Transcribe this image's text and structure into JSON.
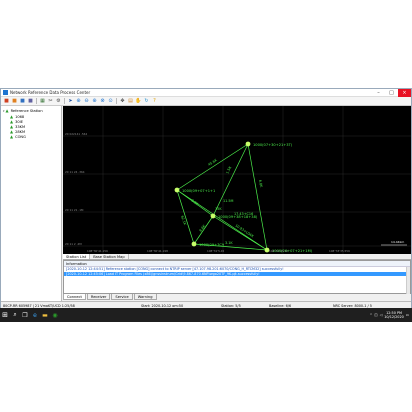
{
  "window": {
    "title": "Network Reference Data Process Center"
  },
  "toolbar": {
    "buttons": [
      {
        "name": "new-icon",
        "glyph": "■",
        "color": "#d04020"
      },
      {
        "name": "open-icon",
        "glyph": "■",
        "color": "#e08020"
      },
      {
        "name": "save-icon",
        "glyph": "■",
        "color": "#3070c0"
      },
      {
        "name": "print-icon",
        "glyph": "■",
        "color": "#6060a0"
      },
      {
        "name": "grid-icon",
        "glyph": "▦",
        "color": "#307030"
      },
      {
        "name": "cut-icon",
        "glyph": "✂",
        "color": "#404040"
      },
      {
        "name": "settings-icon",
        "glyph": "⚙",
        "color": "#505050"
      },
      {
        "name": "arrow-select-icon",
        "glyph": "➤",
        "color": "#2050a0"
      },
      {
        "name": "zoom-in-icon",
        "glyph": "⊕",
        "color": "#1e74d0"
      },
      {
        "name": "zoom-out-icon",
        "glyph": "⊖",
        "color": "#1e74d0"
      },
      {
        "name": "zoom-box-icon",
        "glyph": "⊕",
        "color": "#1e74d0"
      },
      {
        "name": "zoom-fit-icon",
        "glyph": "⊗",
        "color": "#1e74d0"
      },
      {
        "name": "zoom-prev-icon",
        "glyph": "⊙",
        "color": "#1e74d0"
      },
      {
        "name": "pan-icon",
        "glyph": "✥",
        "color": "#3a3a3a"
      },
      {
        "name": "layer-icon",
        "glyph": "▤",
        "color": "#d08020"
      },
      {
        "name": "hand-icon",
        "glyph": "✋",
        "color": "#c08040"
      },
      {
        "name": "refresh-icon",
        "glyph": "↻",
        "color": "#2090d0"
      },
      {
        "name": "help-icon",
        "glyph": "?",
        "color": "#e0a000"
      }
    ]
  },
  "sidebar": {
    "root_label": "Reference Station",
    "stations": [
      "1068",
      "30IE",
      "33KM",
      "28KM",
      "CONG"
    ]
  },
  "map": {
    "y_ticks": [
      "20 022141 .562",
      "20 11 24 .364",
      "20 11 21 .1M",
      "20 11 2 .2M"
    ],
    "x_ticks": [
      "108°30'41.156",
      "108°30'41.198",
      "108°31'5.45",
      "108°31'15.16",
      "108°33'35.556"
    ],
    "scale_label": "14.44km",
    "nodes": [
      {
        "id": "n-top",
        "label": "1000(07+30+21+3T)"
      },
      {
        "id": "n-left",
        "label": "1000(09+07+1+1"
      },
      {
        "id": "n-mid",
        "label": "1000(09+38+18+38)"
      },
      {
        "id": "n-lowleft",
        "label": "1000(09+7C9"
      },
      {
        "id": "n-bottom",
        "label": "1000(26+07+21+1M)"
      }
    ],
    "edge_labels": [
      "45.6K",
      "1.5K",
      "6.8K",
      "0.2K",
      "17.43+C16",
      "62.1K",
      "15K",
      "10.93+L0AK",
      "8.6K",
      "3.1K",
      "11.5M"
    ]
  },
  "tabs_top": [
    "Station List",
    "Base Station Map"
  ],
  "info": {
    "header": "Information",
    "lines": [
      "[2020-10-12 12:44:51] Reference station [CONG] connect to NTRIP server [47.107.98.201:6070/CONG_H_RTCM32] successfully!",
      "[2020-10-12 12:45:06] Load IT Program Files (x86)\\gnssinstrum\\Grid\\9.867-870.6NFtwgo20TF_9K.pjt.successfully!",
      " "
    ]
  },
  "tabs_bottom": [
    "Connect",
    "Receiver",
    "Service",
    "Warning"
  ],
  "status": {
    "left": "80CP-RR 605987 | 21 VmaKT/UCD 1:25/58",
    "start": "Start: 2020-10-12 om:50",
    "station": "Station: 5/5",
    "baseline": "Baseline: 6/6",
    "server": "NRC Server: 8000-1 / 5"
  },
  "taskbar": {
    "apps": [
      {
        "name": "search-icon",
        "glyph": "⌕",
        "color": "#ffffff"
      },
      {
        "name": "task-view-icon",
        "glyph": "❐",
        "color": "#ffffff"
      },
      {
        "name": "edge-icon",
        "glyph": "e",
        "color": "#3aa0f0"
      },
      {
        "name": "folder-icon",
        "glyph": "▬",
        "color": "#f0c040"
      },
      {
        "name": "app-icon",
        "glyph": "◉",
        "color": "#2a9a2a"
      }
    ],
    "time": "12:50 PM",
    "date": "10/12/2020"
  },
  "colors": {
    "network": "#4cf04c",
    "map_bg": "#000000",
    "accent": "#1e74d0"
  }
}
